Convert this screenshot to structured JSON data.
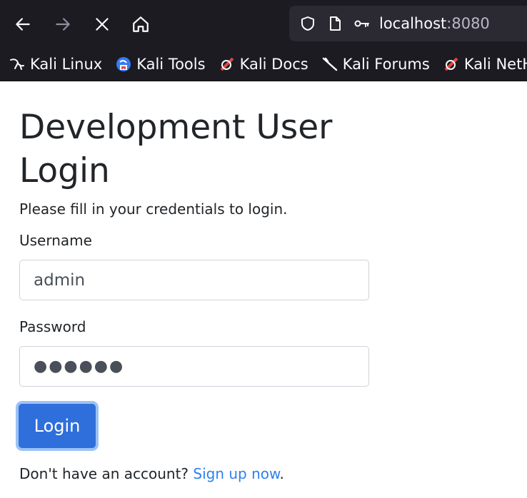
{
  "browser": {
    "url_host": "localhost",
    "url_port": ":8080",
    "bookmarks": [
      {
        "label": "Kali Linux",
        "icon": "kali-dragon-icon"
      },
      {
        "label": "Kali Tools",
        "icon": "kali-tools-icon"
      },
      {
        "label": "Kali Docs",
        "icon": "kali-docs-icon"
      },
      {
        "label": "Kali Forums",
        "icon": "kali-forums-icon"
      },
      {
        "label": "Kali NetH",
        "icon": "kali-nethunter-icon"
      }
    ]
  },
  "page": {
    "title": "Development User Login",
    "subtitle": "Please fill in your credentials to login.",
    "username_label": "Username",
    "username_value": "admin",
    "password_label": "Password",
    "password_masked": "●●●●●●",
    "login_label": "Login",
    "signup_prefix": "Don't have an account? ",
    "signup_link": "Sign up now",
    "signup_suffix": "."
  },
  "colors": {
    "chrome_bg": "#1c1b22",
    "urlbar_bg": "#2b2a33",
    "button_primary": "#2f6fdc",
    "link": "#2f80ed"
  }
}
